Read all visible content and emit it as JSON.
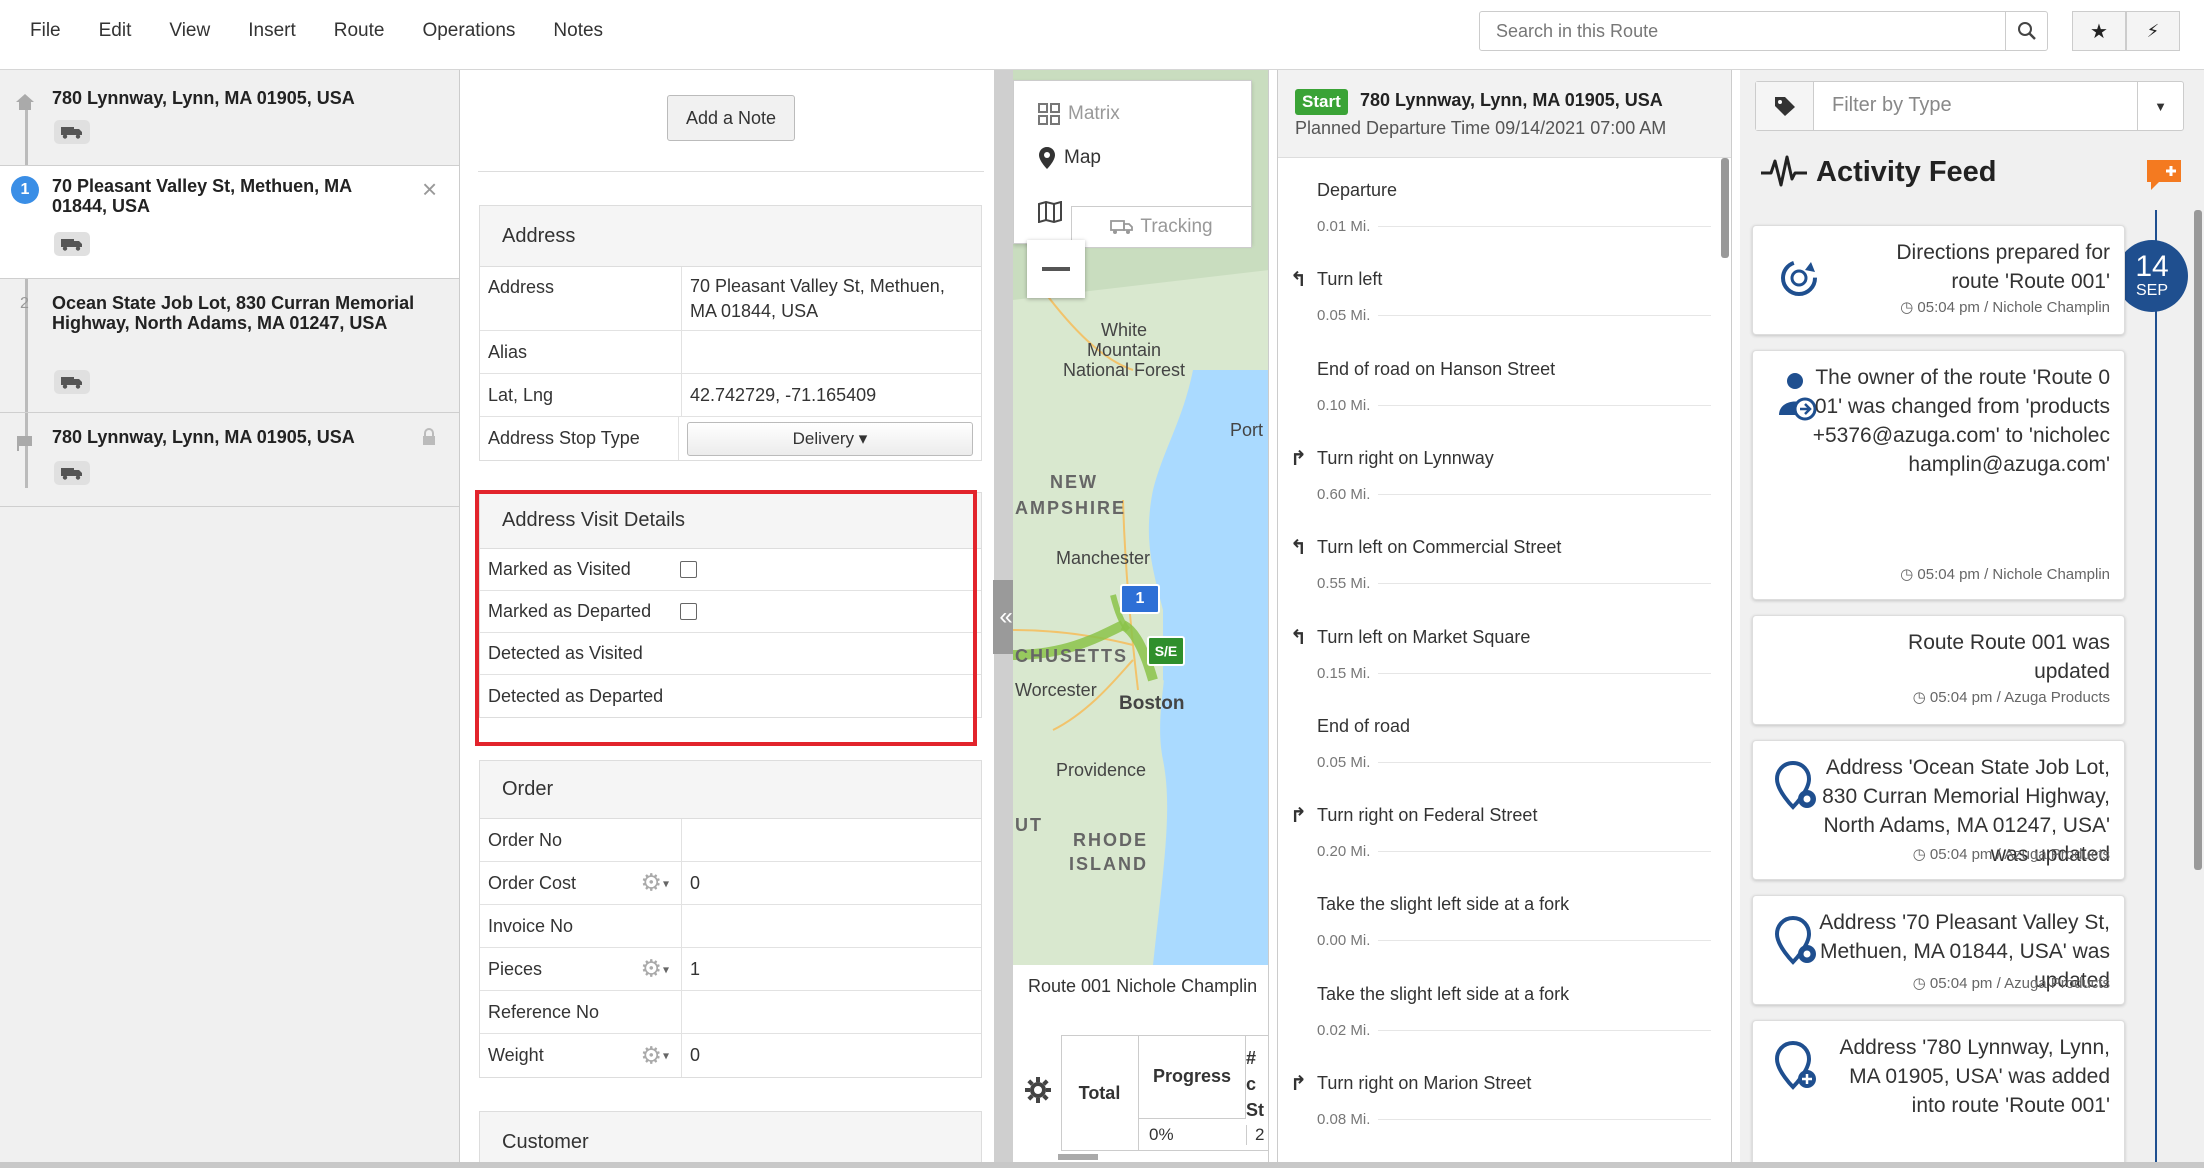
{
  "menu": [
    "File",
    "Edit",
    "View",
    "Insert",
    "Route",
    "Operations",
    "Notes"
  ],
  "search": {
    "placeholder": "Search in this Route"
  },
  "toolbar": {
    "star_label": "★",
    "flash_label": "⚡"
  },
  "stops": [
    {
      "number": "",
      "address": "780 Lynnway, Lynn, MA 01905, USA",
      "type": "start"
    },
    {
      "number": "1",
      "address": "70 Pleasant Valley St, Methuen, MA 01844, USA",
      "type": "selected",
      "close": "×"
    },
    {
      "number": "2",
      "address": "Ocean State Job Lot, 830 Curran Memorial Highway, North Adams, MA 01247, USA",
      "type": "stop"
    },
    {
      "number": "",
      "address": "780 Lynnway, Lynn, MA 01905, USA",
      "type": "end"
    }
  ],
  "details": {
    "add_note": "Add a Note",
    "address_section": {
      "title": "Address",
      "address_label": "Address",
      "address_value": "70 Pleasant Valley St, Methuen, MA 01844, USA",
      "alias_label": "Alias",
      "alias_value": "",
      "latlng_label": "Lat, Lng",
      "latlng_value": "42.742729, -71.165409",
      "stop_type_label": "Address Stop Type",
      "stop_type_value": "Delivery ▾"
    },
    "visit_section": {
      "title": "Address Visit Details",
      "marked_visited": "Marked as Visited",
      "marked_departed": "Marked as Departed",
      "detected_visited": "Detected as Visited",
      "detected_departed": "Detected as Departed"
    },
    "order_section": {
      "title": "Order",
      "order_no_label": "Order No",
      "order_no_value": "",
      "order_cost_label": "Order Cost",
      "order_cost_value": "0",
      "invoice_label": "Invoice No",
      "invoice_value": "",
      "pieces_label": "Pieces",
      "pieces_value": "1",
      "reference_label": "Reference No",
      "reference_value": "",
      "weight_label": "Weight",
      "weight_value": "0"
    },
    "customer_section": {
      "title": "Customer"
    }
  },
  "collapse_label": "«",
  "map": {
    "view_menu": {
      "matrix": "Matrix",
      "map": "Map",
      "tracking": "Tracking"
    },
    "labels": {
      "white_mountain": "White\nMountain\nNational Forest",
      "new_hampshire_1": "NEW",
      "new_hampshire_2": "AMPSHIRE",
      "manchester": "Manchester",
      "port": "Port",
      "worcester": "Worcester",
      "boston": "Boston",
      "providence": "Providence",
      "rhode_1": "RHODE",
      "rhode_2": "ISLAND",
      "ut": "UT",
      "chusetts": "CHUSETTS"
    },
    "markers": {
      "stop1": "1",
      "se": "S/E"
    },
    "route_name": "Route 001 Nichole Champlin",
    "summary": {
      "total": "Total",
      "progress": "Progress",
      "progress_value": "0%",
      "stops_hdr_1": "# c",
      "stops_hdr_2": "St",
      "stops_value": "2"
    }
  },
  "directions": {
    "start_badge": "Start",
    "start_address": "780 Lynnway, Lynn, MA 01905, USA",
    "planned": "Planned Departure Time 09/14/2021 07:00 AM",
    "steps": [
      {
        "arrow": "",
        "text": "Departure",
        "dist": "0.01 Mi."
      },
      {
        "arrow": "↰",
        "text": "Turn left",
        "dist": "0.05 Mi."
      },
      {
        "arrow": "",
        "text": "End of road on Hanson Street",
        "dist": "0.10 Mi."
      },
      {
        "arrow": "↱",
        "text": "Turn right on Lynnway",
        "dist": "0.60 Mi."
      },
      {
        "arrow": "↰",
        "text": "Turn left on Commercial Street",
        "dist": "0.55 Mi."
      },
      {
        "arrow": "↰",
        "text": "Turn left on Market Square",
        "dist": "0.15 Mi."
      },
      {
        "arrow": "",
        "text": "End of road",
        "dist": "0.05 Mi."
      },
      {
        "arrow": "↱",
        "text": "Turn right on Federal Street",
        "dist": "0.20 Mi."
      },
      {
        "arrow": "",
        "text": "Take the slight left side at a fork",
        "dist": "0.00 Mi."
      },
      {
        "arrow": "",
        "text": "Take the slight left side at a fork",
        "dist": "0.02 Mi."
      },
      {
        "arrow": "↱",
        "text": "Turn right on Marion Street",
        "dist": "0.08 Mi."
      }
    ]
  },
  "feed": {
    "filter_placeholder": "Filter by Type",
    "title": "Activity Feed",
    "date_day": "14",
    "date_month": "SEP",
    "items": [
      {
        "icon": "directions-icon",
        "text": "Directions prepared for route 'Route 001'",
        "meta": "05:04 pm / Nichole Champlin"
      },
      {
        "icon": "owner-change-icon",
        "text": "The owner of the route 'Route 001' was changed from 'products+5376@azuga.com' to 'nicholechamplin@azuga.com'",
        "meta": "05:04 pm / Nichole Champlin"
      },
      {
        "icon": "",
        "text": "Route Route 001 was updated",
        "meta": "05:04 pm / Azuga Products"
      },
      {
        "icon": "address-update-icon",
        "text": "Address 'Ocean State Job Lot, 830 Curran Memorial Highway, North Adams, MA 01247, USA' was updated",
        "meta": "05:04 pm / Azuga Products"
      },
      {
        "icon": "address-update-icon",
        "text": "Address '70 Pleasant Valley St, Methuen, MA 01844, USA' was updated",
        "meta": "05:04 pm / Azuga Products"
      },
      {
        "icon": "address-add-icon",
        "text": "Address '780 Lynnway, Lynn, MA 01905, USA' was added into route 'Route 001'",
        "meta": ""
      }
    ]
  },
  "colors": {
    "accent_blue": "#3a8ee6",
    "start_green": "#3aa336",
    "highlight_red": "#e2242c",
    "timeline_navy": "#1f4f8f",
    "feed_orange": "#f47a20"
  }
}
